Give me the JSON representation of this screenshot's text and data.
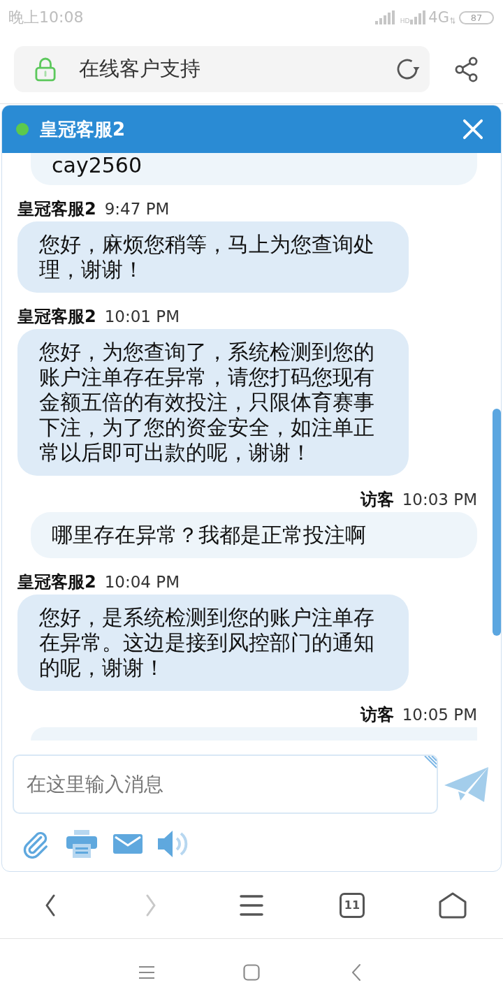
{
  "status_bar": {
    "time": "晚上10:08",
    "hd": "HD",
    "network": "4G",
    "battery": "87"
  },
  "address_bar": {
    "title": "在线客户支持"
  },
  "chat": {
    "title": "皇冠客服2",
    "online": true,
    "messages": [
      {
        "kind": "visitor",
        "text": "cay2560"
      },
      {
        "kind": "agent",
        "sender": "皇冠客服2",
        "time": "9:47 PM",
        "text": "您好，麻烦您稍等，马上为您查询处理，谢谢！"
      },
      {
        "kind": "agent",
        "sender": "皇冠客服2",
        "time": "10:01 PM",
        "text": "您好，为您查询了，系统检测到您的账户注单存在异常，请您打码您现有金额五倍的有效投注，只限体育赛事下注，为了您的资金安全，如注单正常以后即可出款的呢，谢谢！"
      },
      {
        "kind": "visitor",
        "sender": "访客",
        "time": "10:03 PM",
        "text": "哪里存在异常？我都是正常投注啊"
      },
      {
        "kind": "agent",
        "sender": "皇冠客服2",
        "time": "10:04 PM",
        "text": "您好，是系统检测到您的账户注单存在异常。这边是接到风控部门的通知的呢，谢谢！"
      },
      {
        "kind": "visitor",
        "sender": "访客",
        "time": "10:05 PM"
      }
    ],
    "input": {
      "placeholder": "在这里输入消息"
    }
  },
  "browser_toolbar": [
    {
      "kind": "back",
      "disabled": false
    },
    {
      "kind": "forward",
      "disabled": true
    },
    {
      "kind": "menu",
      "disabled": false
    },
    {
      "kind": "tabs",
      "label": "11",
      "disabled": false
    },
    {
      "kind": "home",
      "disabled": false
    }
  ]
}
